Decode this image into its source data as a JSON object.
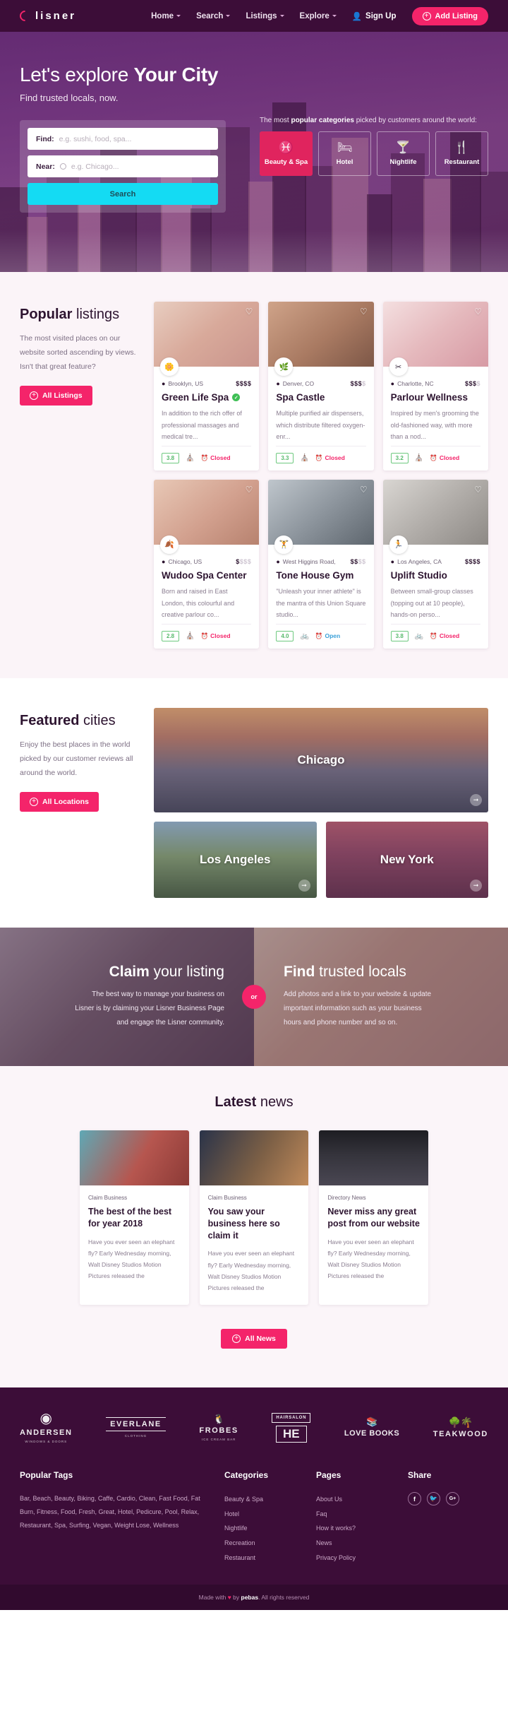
{
  "nav": {
    "brand": "lisner",
    "links": [
      {
        "label": "Home",
        "caret": true
      },
      {
        "label": "Search",
        "caret": true
      },
      {
        "label": "Listings",
        "caret": true
      },
      {
        "label": "Explore",
        "caret": true
      }
    ],
    "signup": "Sign Up",
    "add_listing": "Add Listing"
  },
  "hero": {
    "title_light": "Let's explore ",
    "title_bold": "Your City",
    "subtitle": "Find trusted locals, now.",
    "find_label": "Find:",
    "find_placeholder": "e.g. sushi, food, spa...",
    "near_label": "Near:",
    "near_placeholder": "e.g. Chicago...",
    "search_button": "Search",
    "categories_caption_pre": "The most ",
    "categories_caption_bold": "popular categories",
    "categories_caption_post": " picked by customers around the world:",
    "categories": [
      {
        "label": "Beauty & Spa",
        "icon": "spa-icon",
        "glyph": "♓",
        "active": true
      },
      {
        "label": "Hotel",
        "icon": "hotel-icon",
        "glyph": "🛏",
        "active": false
      },
      {
        "label": "Nightlife",
        "icon": "cocktail-icon",
        "glyph": "🍸",
        "active": false
      },
      {
        "label": "Restaurant",
        "icon": "restaurant-icon",
        "glyph": "🍴",
        "active": false
      }
    ]
  },
  "popular": {
    "title_bold": "Popular",
    "title_light": " listings",
    "lede": "The most visited places on our website sorted ascending by views. Isn't that great feature?",
    "button": "All Listings",
    "listings": [
      {
        "location": "Brooklyn, US",
        "price": "$$$$",
        "price_filled": 4,
        "title": "Green Life Spa",
        "verified": true,
        "desc": "In addition to the rich offer of professional massages and medical tre...",
        "rating": "3.8",
        "amenity_icon": "spa-icon",
        "status": "Closed",
        "open": false
      },
      {
        "location": "Denver, CO",
        "price": "$$$$",
        "price_filled": 3,
        "title": "Spa Castle",
        "verified": false,
        "desc": "Multiple purified air dispensers, which distribute filtered oxygen-enr...",
        "rating": "3.3",
        "amenity_icon": "spa-icon",
        "status": "Closed",
        "open": false
      },
      {
        "location": "Charlotte, NC",
        "price": "$$$$",
        "price_filled": 3,
        "title": "Parlour Wellness",
        "verified": false,
        "desc": "Inspired by men's grooming the old-fashioned way, with more than a nod...",
        "rating": "3.2",
        "amenity_icon": "spa-icon",
        "status": "Closed",
        "open": false
      },
      {
        "location": "Chicago, US",
        "price": "$$$$",
        "price_filled": 1,
        "title": "Wudoo Spa Center",
        "verified": false,
        "desc": "Born and raised in East London, this colourful and creative parlour co...",
        "rating": "2.8",
        "amenity_icon": "spa-icon",
        "status": "Closed",
        "open": false
      },
      {
        "location": "West Higgins Road,",
        "price": "$$$$",
        "price_filled": 2,
        "title": "Tone House Gym",
        "verified": false,
        "desc": "\"Unleash your inner athlete\" is the mantra of this Union Square studio...",
        "rating": "4.0",
        "amenity_icon": "bike-icon",
        "status": "Open",
        "open": true
      },
      {
        "location": "Los Angeles, CA",
        "price": "$$$$",
        "price_filled": 4,
        "title": "Uplift Studio",
        "verified": false,
        "desc": "Between small-group classes (topping out at 10 people), hands-on perso...",
        "rating": "3.8",
        "amenity_icon": "bike-icon",
        "status": "Closed",
        "open": false
      }
    ]
  },
  "featured": {
    "title_bold": "Featured",
    "title_light": " cities",
    "lede": "Enjoy the best places in the world picked by our customer reviews all around the world.",
    "button": "All Locations",
    "cities": [
      {
        "name": "Chicago"
      },
      {
        "name": "Los Angeles"
      },
      {
        "name": "New York"
      }
    ]
  },
  "cta": {
    "or": "or",
    "left": {
      "title_bold": "Claim",
      "title_light": " your listing",
      "text": "The best way to manage your business on Lisner is by claiming your Lisner Business Page and engage the Lisner community."
    },
    "right": {
      "title_bold": "Find",
      "title_light": " trusted locals",
      "text": "Add photos and a link to your website & update important information such as your business hours and phone number and so on."
    }
  },
  "news": {
    "title_bold": "Latest",
    "title_light": " news",
    "button": "All News",
    "posts": [
      {
        "category": "Claim Business",
        "title": "The best of the best for year 2018",
        "excerpt": "Have you ever seen an elephant fly?   Early Wednesday morning, Walt Disney Studios Motion Pictures released the"
      },
      {
        "category": "Claim Business",
        "title": "You saw your business here so claim it",
        "excerpt": "Have you ever seen an elephant fly?   Early Wednesday morning, Walt Disney Studios Motion Pictures released the"
      },
      {
        "category": "Directory News",
        "title": "Never miss any great post from our website",
        "excerpt": "Have you ever seen an elephant fly?   Early Wednesday morning, Walt Disney Studios Motion Pictures released the"
      }
    ]
  },
  "partners": [
    {
      "name": "ANDERSEN",
      "sub": "WINDOWS & DOORS"
    },
    {
      "name": "EVERLANE",
      "sub": "CLOTHING"
    },
    {
      "name": "FROBES",
      "sub": "ICE CREAM BAR"
    },
    {
      "name": "HAIRSALON",
      "sub": ""
    },
    {
      "name": "LOVE BOOKS",
      "sub": ""
    },
    {
      "name": "TEAKWOOD",
      "sub": ""
    }
  ],
  "footer": {
    "tags_heading": "Popular Tags",
    "tags": "Bar, Beach, Beauty, Biking, Caffe, Cardio, Clean, Fast Food, Fat Burn, Fitness, Food, Fresh, Great, Hotel, Pedicure, Pool, Relax, Restaurant, Spa, Surfing, Vegan, Weight Lose, Wellness",
    "categories_heading": "Categories",
    "categories": [
      "Beauty & Spa",
      "Hotel",
      "Nightlife",
      "Recreation",
      "Restaurant"
    ],
    "pages_heading": "Pages",
    "pages": [
      "About Us",
      "Faq",
      "How it works?",
      "News",
      "Privacy Policy"
    ],
    "share_heading": "Share",
    "socials": [
      {
        "icon": "facebook-icon",
        "glyph": "f"
      },
      {
        "icon": "twitter-icon",
        "glyph": "ᴠ"
      },
      {
        "icon": "google-plus-icon",
        "glyph": "G+"
      }
    ],
    "copyright_pre": "Made with ",
    "copyright_heart": "♥",
    "copyright_mid": " by ",
    "copyright_brand": "pebas",
    "copyright_post": ". All rights reserved"
  },
  "colors": {
    "brand_pink": "#f4246a",
    "deep_purple": "#3c0d38",
    "cyan": "#14dbf3"
  }
}
